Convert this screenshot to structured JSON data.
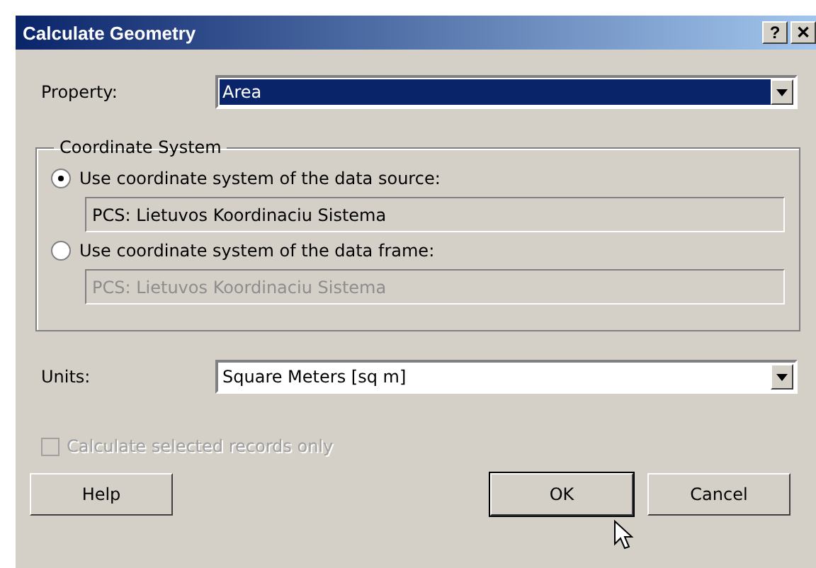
{
  "window": {
    "title": "Calculate Geometry",
    "title_buttons": [
      "?",
      "✕"
    ]
  },
  "property": {
    "label": "Property:",
    "value": "Area",
    "focused": true
  },
  "coordinate_system": {
    "title": "Coordinate System",
    "options": [
      {
        "label": "Use coordinate system of the data source:",
        "selected": true,
        "value": "PCS: Lietuvos Koordinaciu Sistema",
        "disabled": false
      },
      {
        "label": "Use coordinate system of the data frame:",
        "selected": false,
        "value": "PCS: Lietuvos Koordinaciu Sistema",
        "disabled": true
      }
    ]
  },
  "units": {
    "label": "Units:",
    "value": "Square Meters [sq m]",
    "focused": false
  },
  "selected_only": {
    "label": "Calculate selected records only",
    "checked": false,
    "disabled": true
  },
  "buttons": [
    {
      "label": "Help",
      "default": false
    },
    {
      "label": "OK",
      "default": true
    },
    {
      "label": "Cancel",
      "default": false
    }
  ]
}
